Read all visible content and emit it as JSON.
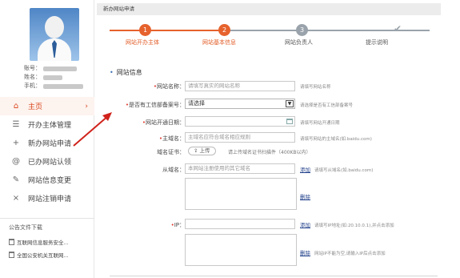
{
  "colors": {
    "accent": "#e6622d",
    "inactive_step": "#9aa3ab",
    "link": "#1f3f8a",
    "required": "#e03a2e"
  },
  "sidebar": {
    "user": {
      "account_label": "账号：",
      "name_label": "姓名：",
      "phone_label": "手机："
    },
    "nav": [
      {
        "label": "主页",
        "icon": "home-icon",
        "active": true
      },
      {
        "label": "开办主体管理",
        "icon": "list-icon"
      },
      {
        "label": "新办网站申请",
        "icon": "plus-icon"
      },
      {
        "label": "已办网站认领",
        "icon": "at-icon"
      },
      {
        "label": "网站信息变更",
        "icon": "edit-icon"
      },
      {
        "label": "网站注销申请",
        "icon": "close-icon"
      }
    ],
    "notice": {
      "title": "公告文件下载",
      "items": [
        "互联网信息服务安全...",
        "全国公安机关互联网..."
      ]
    }
  },
  "breadcrumb": "新办网站申请",
  "steps": [
    {
      "num": "1",
      "label": "网站开办主体",
      "status": "done"
    },
    {
      "num": "2",
      "label": "网站基本信息",
      "status": "done"
    },
    {
      "num": "3",
      "label": "网站负责人",
      "status": "todo"
    },
    {
      "num": "",
      "label": "提示说明",
      "status": "todo"
    }
  ],
  "form": {
    "section_title": "网站信息",
    "site_name": {
      "label": "网站名称：",
      "placeholder": "请填写真实的网站名称",
      "hint": "请填写网站名称"
    },
    "icp": {
      "label": "是否有工信部备案号：",
      "value": "请选择",
      "hint": "请选择是否有工信部备案号"
    },
    "open_date": {
      "label": "网站开通日期：",
      "hint": "请填写网站开通日期"
    },
    "domain": {
      "label": "主域名：",
      "placeholder": "主域名应符合域名相应规则",
      "hint": "请填写网站的主域名(如.baidu.com)"
    },
    "cert": {
      "label": "域名证书：",
      "button": "上传",
      "hint": "请上传域名证书扫描件（400KB以内）"
    },
    "sub_domain": {
      "label": "从域名：",
      "placeholder": "本网站注册使用的其它域名",
      "add": "添加",
      "hint": "请填写从域名(如.baidu.com)",
      "delete": "删除"
    },
    "ip": {
      "label": "IP：",
      "add": "添加",
      "hint": "请填写IP地址(如:20.10.0.1),并点击添加",
      "delete": "删除",
      "delete_hint": "网站IP不能为空,请输入IP后点击添加"
    }
  }
}
